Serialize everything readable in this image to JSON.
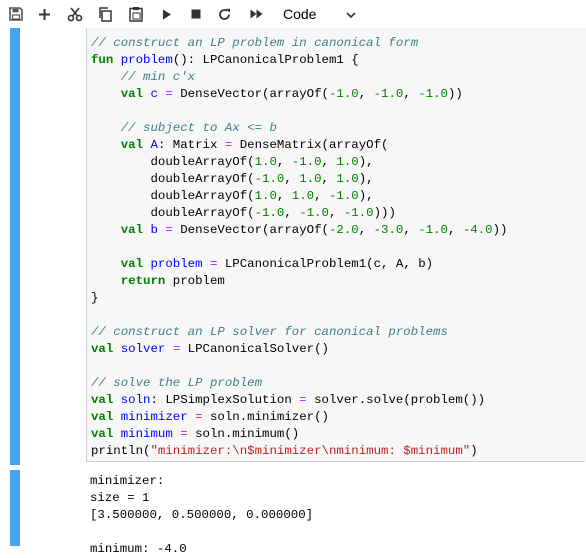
{
  "toolbar": {
    "buttons": [
      "save-icon",
      "add-icon",
      "cut-icon",
      "copy-icon",
      "paste-icon",
      "run-icon",
      "stop-icon",
      "restart-icon",
      "fast-forward-icon"
    ],
    "cell_type": "Code"
  },
  "cell": {
    "code_lines": [
      "// construct an LP problem in canonical form",
      "fun problem(): LPCanonicalProblem1 {",
      "    // min c'x",
      "    val c = DenseVector(arrayOf(-1.0, -1.0, -1.0))",
      "",
      "    // subject to Ax <= b",
      "    val A: Matrix = DenseMatrix(arrayOf(",
      "        doubleArrayOf(1.0, -1.0, 1.0),",
      "        doubleArrayOf(-1.0, 1.0, 1.0),",
      "        doubleArrayOf(1.0, 1.0, -1.0),",
      "        doubleArrayOf(-1.0, -1.0, -1.0)))",
      "    val b = DenseVector(arrayOf(-2.0, -3.0, -1.0, -4.0))",
      "",
      "    val problem = LPCanonicalProblem1(c, A, b)",
      "    return problem",
      "}",
      "",
      "// construct an LP solver for canonical problems",
      "val solver = LPCanonicalSolver()",
      "",
      "// solve the LP problem",
      "val soln: LPSimplexSolution = solver.solve(problem())",
      "val minimizer = soln.minimizer()",
      "val minimum = soln.minimum()",
      "println(\"minimizer:\\n$minimizer\\nminimum: $minimum\")"
    ],
    "output_lines": [
      "minimizer:",
      "size = 1",
      "[3.500000, 0.500000, 0.000000]",
      "",
      "minimum: -4.0"
    ]
  },
  "colors": {
    "accent": "#42a5f5",
    "comment": "#408080",
    "keyword": "#008000",
    "definition": "#0000ff",
    "string": "#ba2121"
  }
}
